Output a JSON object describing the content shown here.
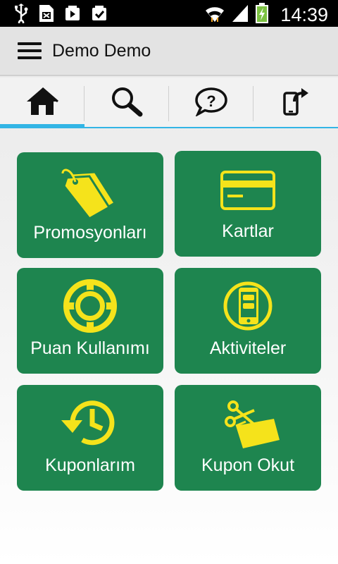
{
  "status_bar": {
    "time": "14:39",
    "icons": [
      "usb-icon",
      "sim-card-icon",
      "media-icon",
      "task-icon",
      "wifi-icon",
      "signal-icon",
      "battery-charging-icon"
    ]
  },
  "action_bar": {
    "title": "Demo Demo",
    "menu_icon": "hamburger-menu-icon"
  },
  "tabs": [
    {
      "icon": "home-icon",
      "active": true
    },
    {
      "icon": "search-icon",
      "active": false
    },
    {
      "icon": "help-icon",
      "active": false
    },
    {
      "icon": "share-icon",
      "active": false
    }
  ],
  "tiles": [
    {
      "label": "Promosyonları",
      "icon": "price-tag-icon"
    },
    {
      "label": "Kartlar",
      "icon": "credit-card-icon"
    },
    {
      "label": "Puan Kullanımı",
      "icon": "lifebuoy-icon"
    },
    {
      "label": "Aktiviteler",
      "icon": "phone-activity-icon"
    },
    {
      "label": "Kuponlarım",
      "icon": "history-icon"
    },
    {
      "label": "Kupon Okut",
      "icon": "coupon-scissors-icon"
    }
  ],
  "colors": {
    "tile_background": "#1e854f",
    "tile_icon": "#f5e31b",
    "tab_indicator": "#33b5e5",
    "status_bar": "#000000"
  }
}
